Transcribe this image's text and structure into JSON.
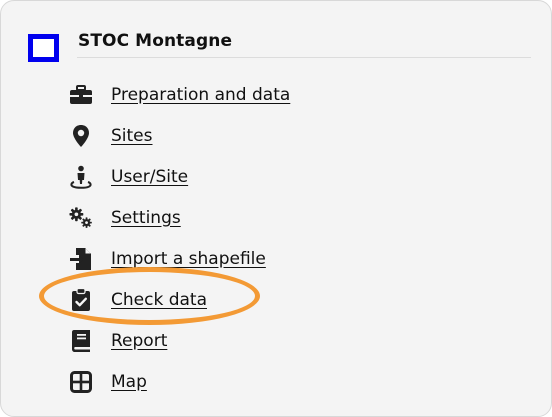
{
  "panel": {
    "logo_icon": "blue-square-icon",
    "title": "STOC Montagne"
  },
  "menu": {
    "items": [
      {
        "label": "Preparation and data",
        "icon": "toolbox-icon"
      },
      {
        "label": "Sites",
        "icon": "map-pin-icon"
      },
      {
        "label": "User/Site",
        "icon": "person-location-icon"
      },
      {
        "label": "Settings",
        "icon": "gears-icon"
      },
      {
        "label": "Import a shapefile",
        "icon": "file-import-icon"
      },
      {
        "label": "Check data",
        "icon": "clipboard-check-icon"
      },
      {
        "label": "Report",
        "icon": "book-icon"
      },
      {
        "label": "Map",
        "icon": "grid-icon"
      }
    ]
  },
  "colors": {
    "logo_border": "#0000ee",
    "highlight": "#f39a35",
    "panel_bg": "#f4f4f4",
    "icon": "#222222"
  }
}
